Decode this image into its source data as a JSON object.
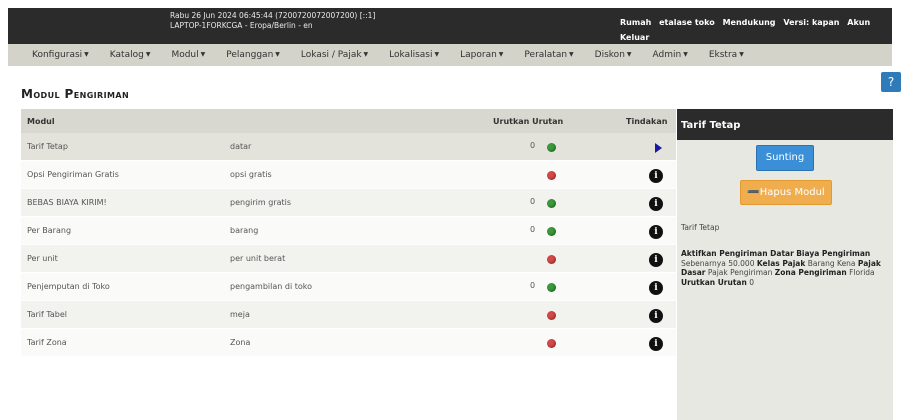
{
  "topbar": {
    "datetime": "Rabu 26 Jun 2024 06:45:44 (7200720072007200) [::1]",
    "host": "LAPTOP-1FORKCGA - Eropa/Berlin - en",
    "links": [
      "Rumah",
      "etalase toko",
      "Mendukung",
      "Versi: kapan",
      "Akun",
      "Keluar"
    ]
  },
  "menu": [
    "Konfigurasi",
    "Katalog",
    "Modul",
    "Pelanggan",
    "Lokasi / Pajak",
    "Lokalisasi",
    "Laporan",
    "Peralatan",
    "Diskon",
    "Admin",
    "Ekstra"
  ],
  "help_label": "?",
  "page_title": "Modul Pengiriman",
  "table": {
    "headers": {
      "module": "Modul",
      "sort": "Urutkan Urutan",
      "action": "Tindakan"
    },
    "rows": [
      {
        "name": "Tarif Tetap",
        "code": "datar",
        "sort": "0",
        "status": "green",
        "action": "play"
      },
      {
        "name": "Opsi Pengiriman Gratis",
        "code": "opsi gratis",
        "sort": "",
        "status": "red",
        "action": "info"
      },
      {
        "name": "BEBAS BIAYA KIRIM!",
        "code": "pengirim gratis",
        "sort": "0",
        "status": "green",
        "action": "info"
      },
      {
        "name": "Per Barang",
        "code": "barang",
        "sort": "0",
        "status": "green",
        "action": "info"
      },
      {
        "name": "Per unit",
        "code": "per unit berat",
        "sort": "",
        "status": "red",
        "action": "info"
      },
      {
        "name": "Penjemputan di Toko",
        "code": "pengambilan di toko",
        "sort": "0",
        "status": "green",
        "action": "info"
      },
      {
        "name": "Tarif Tabel",
        "code": "meja",
        "sort": "",
        "status": "red",
        "action": "info"
      },
      {
        "name": "Tarif Zona",
        "code": "Zona",
        "sort": "",
        "status": "red",
        "action": "info"
      }
    ]
  },
  "panel": {
    "title": "Tarif Tetap",
    "edit_label": "Sunting",
    "delete_label": "➖Hapus Modul",
    "module_name": "Tarif Tetap",
    "desc": {
      "l1": "Aktifkan Pengiriman Datar",
      "l2": "Biaya Pengiriman",
      "l3": "Sebenarnya 50.000",
      "l4": "Kelas Pajak",
      "l5": "Barang Kena",
      "l6": "Pajak Dasar",
      "l7": "Pajak Pengiriman",
      "l8": "Zona Pengiriman",
      "l9": "Florida",
      "l10": "Urutkan Urutan",
      "l11": "0"
    }
  },
  "colors": {
    "header_bg": "#2b2b2b",
    "menu_bg": "#d3d3ca",
    "edit_btn": "#3a8fd6",
    "delete_btn": "#f0ad4e",
    "status_on": "#3a9a3a",
    "status_off": "#d64848"
  }
}
